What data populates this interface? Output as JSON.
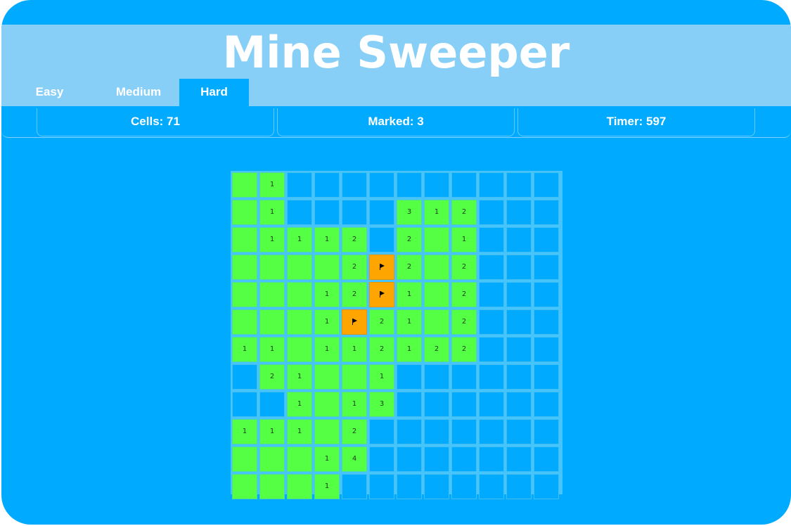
{
  "title": "Mine Sweeper",
  "tabs": [
    {
      "label": "Easy",
      "active": false
    },
    {
      "label": "Medium",
      "active": false
    },
    {
      "label": "Hard",
      "active": true
    }
  ],
  "stats": {
    "cells": "Cells: 71",
    "marked": "Marked: 3",
    "timer": "Timer: 597"
  },
  "colors": {
    "background": "#00abff",
    "header": "#88cff8",
    "revealed_cell": "#55ff44",
    "flagged_cell": "#ffa500",
    "hidden_cell": "#00abff"
  },
  "board": {
    "rows": 12,
    "cols": 12,
    "legend": {
      "H": "hidden",
      "O": "revealed empty",
      "F": "flagged",
      "1-9": "revealed number"
    },
    "grid": [
      [
        "O",
        "1",
        "H",
        "H",
        "H",
        "H",
        "H",
        "H",
        "H",
        "H",
        "H",
        "H"
      ],
      [
        "O",
        "1",
        "H",
        "H",
        "H",
        "H",
        "3",
        "1",
        "2",
        "H",
        "H",
        "H"
      ],
      [
        "O",
        "1",
        "1",
        "1",
        "2",
        "H",
        "2",
        "O",
        "1",
        "H",
        "H",
        "H"
      ],
      [
        "O",
        "O",
        "O",
        "O",
        "2",
        "F",
        "2",
        "O",
        "2",
        "H",
        "H",
        "H"
      ],
      [
        "O",
        "O",
        "O",
        "1",
        "2",
        "F",
        "1",
        "O",
        "2",
        "H",
        "H",
        "H"
      ],
      [
        "O",
        "O",
        "O",
        "1",
        "F",
        "2",
        "1",
        "O",
        "2",
        "H",
        "H",
        "H"
      ],
      [
        "1",
        "1",
        "O",
        "1",
        "1",
        "2",
        "1",
        "2",
        "2",
        "H",
        "H",
        "H"
      ],
      [
        "H",
        "2",
        "1",
        "O",
        "O",
        "1",
        "H",
        "H",
        "H",
        "H",
        "H",
        "H"
      ],
      [
        "H",
        "H",
        "1",
        "O",
        "1",
        "3",
        "H",
        "H",
        "H",
        "H",
        "H",
        "H"
      ],
      [
        "1",
        "1",
        "1",
        "O",
        "2",
        "H",
        "H",
        "H",
        "H",
        "H",
        "H",
        "H"
      ],
      [
        "O",
        "O",
        "O",
        "1",
        "4",
        "H",
        "H",
        "H",
        "H",
        "H",
        "H",
        "H"
      ],
      [
        "O",
        "O",
        "O",
        "1",
        "H",
        "H",
        "H",
        "H",
        "H",
        "H",
        "H",
        "H"
      ]
    ]
  }
}
